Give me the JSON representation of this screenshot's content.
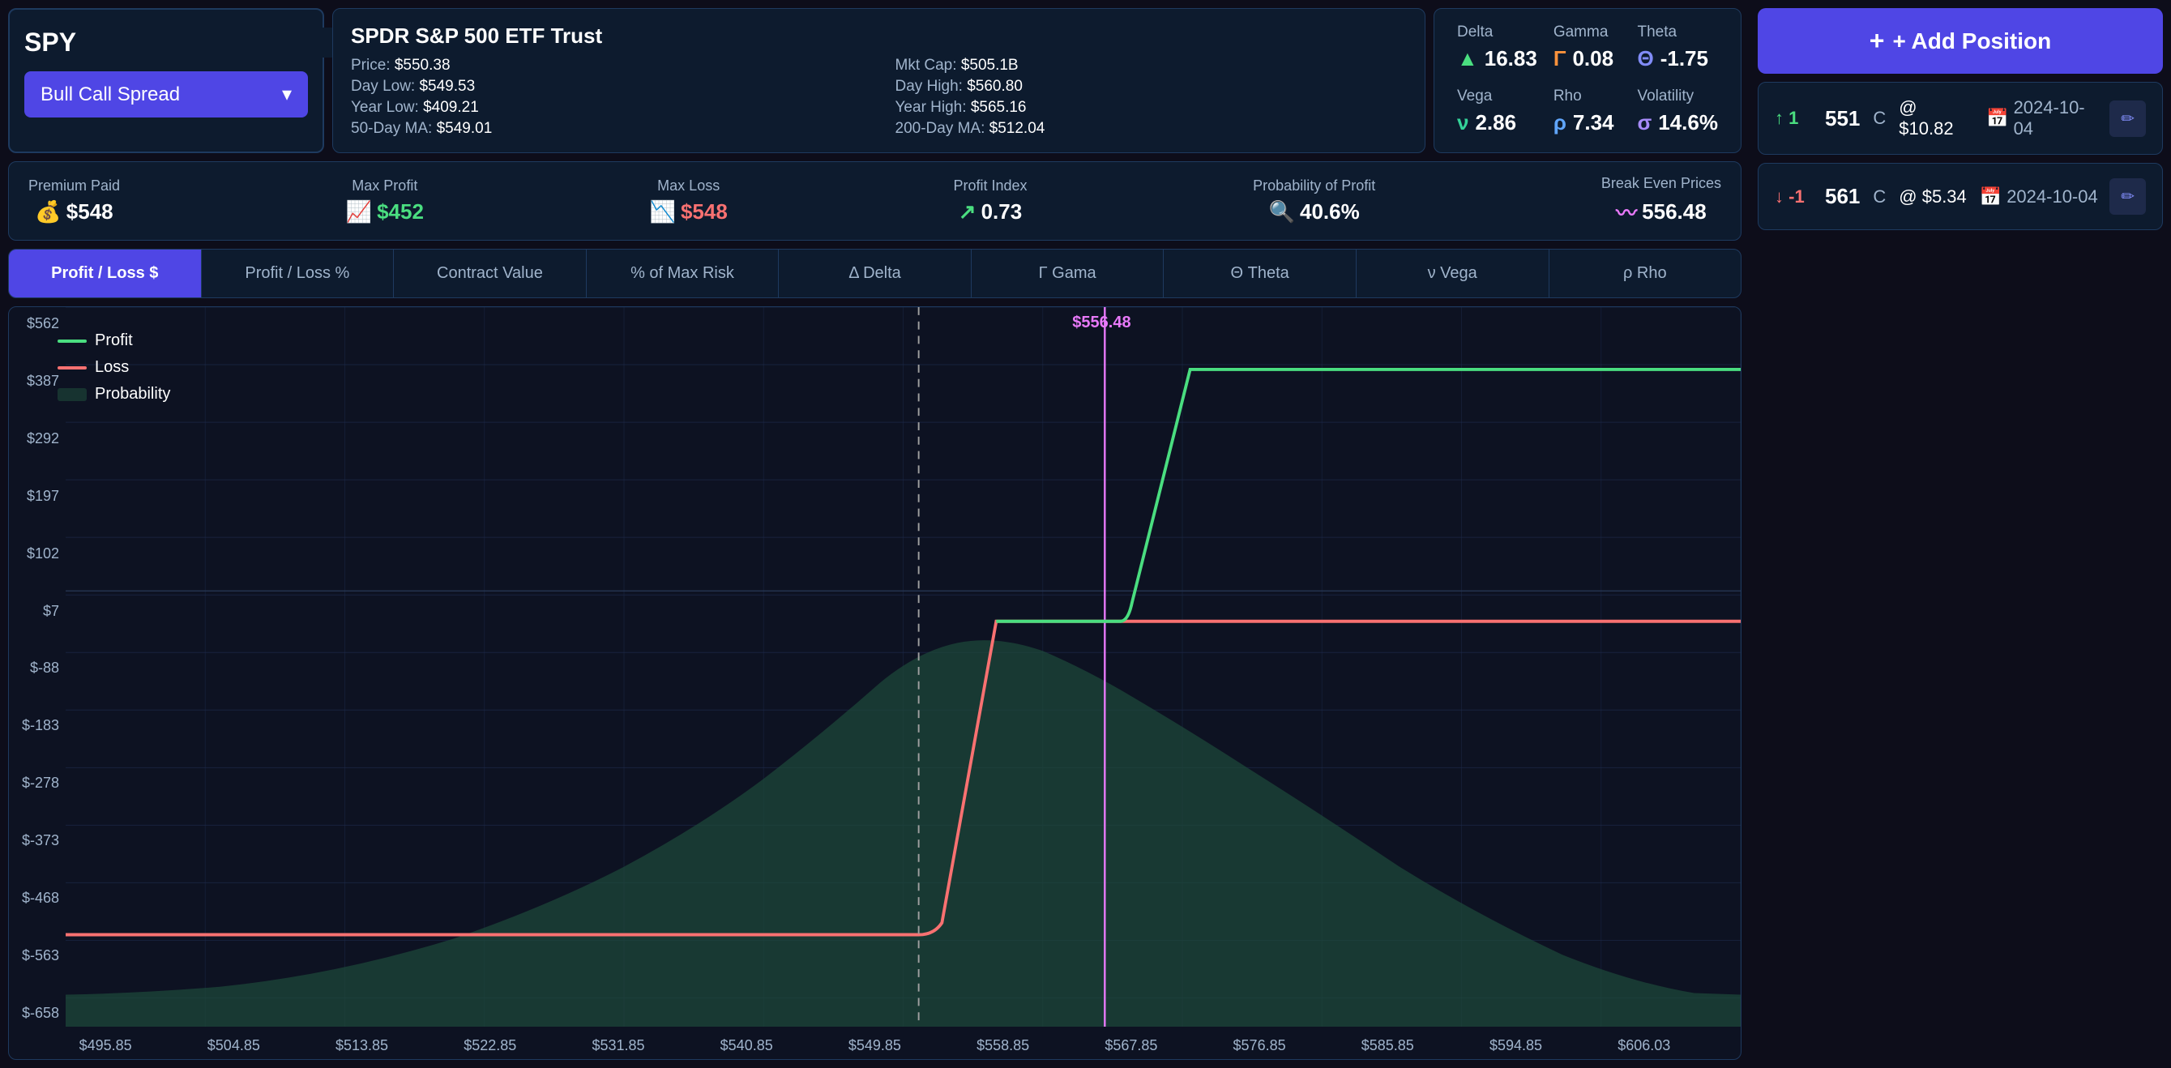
{
  "ticker": {
    "symbol": "SPY",
    "strategy": "Bull Call Spread",
    "icon1": "📈",
    "icon2": "📊"
  },
  "stock": {
    "name": "SPDR S&P 500 ETF Trust",
    "price": "$550.38",
    "day_low": "$549.53",
    "year_low": "$409.21",
    "ma50": "$549.01",
    "mkt_cap": "$505.1B",
    "day_high": "$560.80",
    "year_high": "$565.16",
    "ma200": "$512.04"
  },
  "greeks": {
    "delta_label": "Delta",
    "delta_value": "16.83",
    "gamma_label": "Gamma",
    "gamma_value": "0.08",
    "theta_label": "Theta",
    "theta_value": "-1.75",
    "vega_label": "Vega",
    "vega_value": "2.86",
    "rho_label": "Rho",
    "rho_value": "7.34",
    "volatility_label": "Volatility",
    "volatility_value": "14.6%"
  },
  "metrics": {
    "premium_paid_label": "Premium Paid",
    "premium_paid_value": "$548",
    "max_profit_label": "Max Profit",
    "max_profit_value": "$452",
    "max_loss_label": "Max Loss",
    "max_loss_value": "$548",
    "profit_index_label": "Profit Index",
    "profit_index_value": "0.73",
    "pop_label": "Probability of Profit",
    "pop_value": "40.6%",
    "break_even_label": "Break Even Prices",
    "break_even_value": "556.48"
  },
  "tabs": [
    {
      "label": "Profit / Loss $",
      "active": true
    },
    {
      "label": "Profit / Loss %",
      "active": false
    },
    {
      "label": "Contract Value",
      "active": false
    },
    {
      "label": "% of Max Risk",
      "active": false
    },
    {
      "label": "Δ Delta",
      "active": false
    },
    {
      "label": "Γ Gama",
      "active": false
    },
    {
      "label": "Θ Theta",
      "active": false
    },
    {
      "label": "ν Vega",
      "active": false
    },
    {
      "label": "ρ Rho",
      "active": false
    }
  ],
  "chart": {
    "break_even_label": "$556.48",
    "y_axis": [
      "$562",
      "$387",
      "$292",
      "$197",
      "$102",
      "$7",
      "$-88",
      "$-183",
      "$-278",
      "$-373",
      "$-468",
      "$-563",
      "$-658"
    ],
    "x_axis": [
      "$495.85",
      "$504.85",
      "$513.85",
      "$522.85",
      "$531.85",
      "$540.85",
      "$549.85",
      "$558.85",
      "$567.85",
      "$576.85",
      "$585.85",
      "$594.85",
      "$606.03"
    ],
    "legend": {
      "profit_label": "Profit",
      "loss_label": "Loss",
      "probability_label": "Probability"
    }
  },
  "positions": [
    {
      "direction": "↑ 1",
      "strike": "551",
      "type": "C",
      "price": "@ $10.82",
      "date": "2024-10-04"
    },
    {
      "direction": "↓ -1",
      "strike": "561",
      "type": "C",
      "price": "@ $5.34",
      "date": "2024-10-04"
    }
  ],
  "add_position_label": "+ Add Position"
}
